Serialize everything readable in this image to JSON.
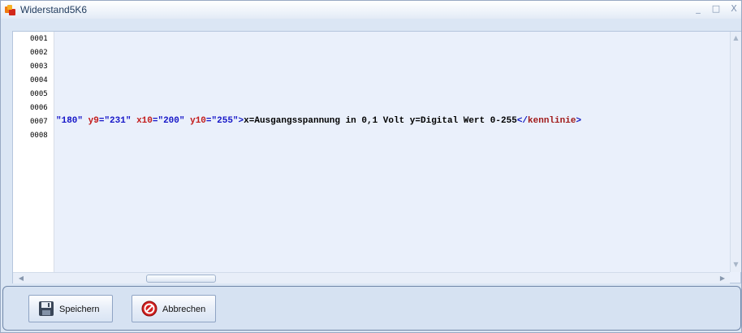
{
  "window": {
    "title": "Widerstand5K6",
    "icon": "app-logo-icon",
    "controls": {
      "minimize": "_",
      "maximize": "□",
      "close": "X"
    }
  },
  "editor": {
    "line_numbers": [
      "0001",
      "0002",
      "0003",
      "0004",
      "0005",
      "0006",
      "0007",
      "0008"
    ],
    "line7_tokens": [
      {
        "t": "\"180\"",
        "c": "tok-val"
      },
      {
        "t": " ",
        "c": "tok-text"
      },
      {
        "t": "y9",
        "c": "tok-attr"
      },
      {
        "t": "=",
        "c": "tok-eq"
      },
      {
        "t": "\"231\"",
        "c": "tok-val"
      },
      {
        "t": " ",
        "c": "tok-text"
      },
      {
        "t": "x10",
        "c": "tok-attr"
      },
      {
        "t": "=",
        "c": "tok-eq"
      },
      {
        "t": "\"200\"",
        "c": "tok-val"
      },
      {
        "t": " ",
        "c": "tok-text"
      },
      {
        "t": "y10",
        "c": "tok-attr"
      },
      {
        "t": "=",
        "c": "tok-eq"
      },
      {
        "t": "\"255\"",
        "c": "tok-val"
      },
      {
        "t": ">",
        "c": "tok-tag"
      },
      {
        "t": "x=Ausgangsspannung in 0,1 Volt y=Digital Wert 0-255",
        "c": "tok-text"
      },
      {
        "t": "</",
        "c": "tok-tag"
      },
      {
        "t": "kennlinie",
        "c": "tok-tagname"
      },
      {
        "t": ">",
        "c": "tok-tag"
      }
    ]
  },
  "buttons": {
    "save": "Speichern",
    "cancel": "Abbrechen"
  },
  "colors": {
    "attribute": "#c31b1b",
    "value": "#1515c8",
    "tag": "#0e16c0",
    "editor_bg": "#eaf0fb"
  }
}
